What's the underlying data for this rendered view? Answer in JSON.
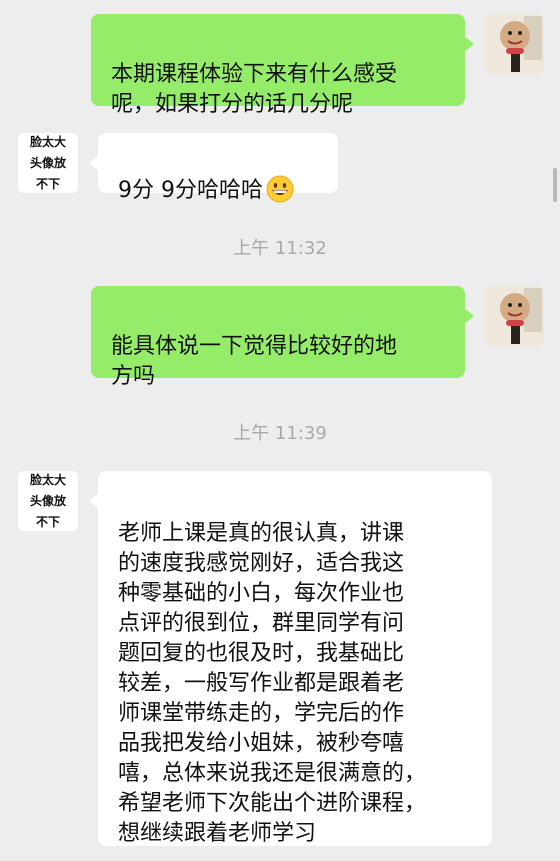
{
  "messages": [
    {
      "side": "right",
      "text": "本期课程体验下来有什么感受\n呢，如果打分的话几分呢"
    },
    {
      "side": "left",
      "sender": "脸太大头像放不下",
      "text": "9分 9分哈哈哈",
      "emoji": "grinning-face-emoji"
    },
    {
      "type": "time",
      "text": "上午 11:32"
    },
    {
      "side": "right",
      "text": "能具体说一下觉得比较好的地\n方吗"
    },
    {
      "type": "time",
      "text": "上午 11:39"
    },
    {
      "side": "left",
      "sender": "脸太大头像放不下",
      "text": "老师上课是真的很认真，讲课\n的速度我感觉刚好，适合我这\n种零基础的小白，每次作业也\n点评的很到位，群里同学有问\n题回复的也很及时，我基础比\n较差，一般写作业都是跟着老\n师课堂带练走的，学完后的作\n品我把发给小姐妹，被秒夸嘻\n嘻，总体来说我还是很满意的，\n希望老师下次能出个进阶课程，\n想继续跟着老师学习"
    }
  ],
  "colors": {
    "background": "#ededed",
    "self_bubble": "#95ec69",
    "other_bubble": "#ffffff",
    "timestamp": "#a8a8a8"
  }
}
